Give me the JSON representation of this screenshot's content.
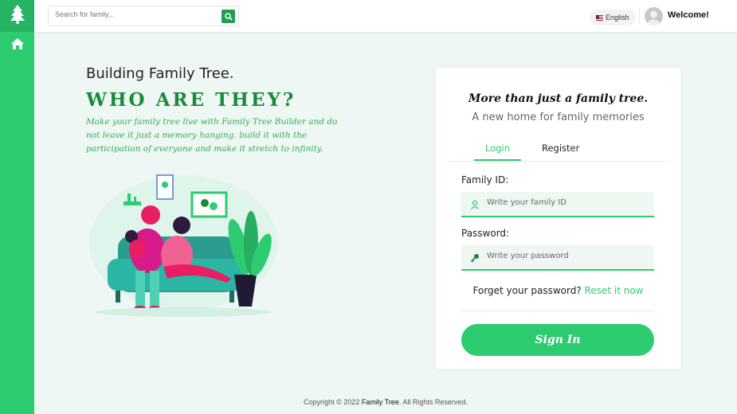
{
  "header": {
    "search_placeholder": "Search for family...",
    "language": "English",
    "welcome": "Welcome!"
  },
  "hero": {
    "title": "Building Family Tree.",
    "headline": "WHO ARE THEY?",
    "description": "Make your family tree live with Family Tree Builder and do not leave it just a memory hanging. build it with the participation of everyone and make it stretch to infinity."
  },
  "card": {
    "tagline": "More than just a family tree.",
    "subtitle": "A new home for family memories",
    "tabs": [
      "Login",
      "Register"
    ],
    "family_id_label": "Family ID:",
    "family_id_placeholder": "Write your family ID",
    "password_label": "Password:",
    "password_placeholder": "Write your password",
    "forgot_text": "Forget your password?",
    "reset_link": "Reset it now",
    "sign_in": "Sign In"
  },
  "footer": {
    "prefix": "Copyright © 2022",
    "brand": "Family Tree",
    "suffix": ". All Rights Reserved."
  },
  "colors": {
    "accent": "#2ecc71",
    "accent_dark": "#1a8a3a",
    "background": "#eef7f3"
  },
  "icons": [
    "tree-icon",
    "home-icon",
    "search-icon",
    "us-flag-icon",
    "user-icon",
    "key-icon"
  ]
}
